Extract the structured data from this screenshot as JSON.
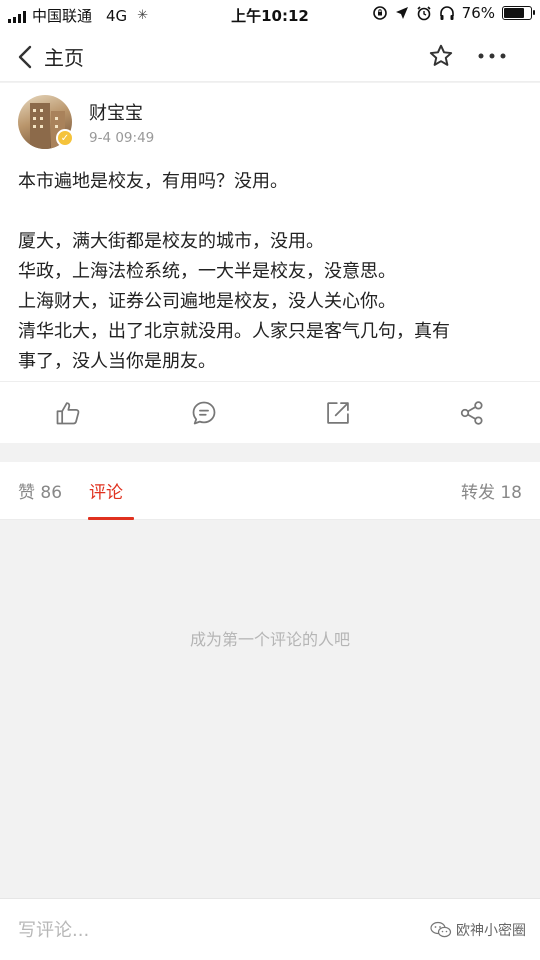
{
  "status_bar": {
    "carrier": "中国联通",
    "network": "4G",
    "time": "上午10:12",
    "battery_percent": "76%",
    "battery_level": 0.76
  },
  "nav": {
    "title": "主页",
    "icons": [
      "back-arrow-icon",
      "star-icon",
      "more-icon"
    ]
  },
  "post": {
    "author": "财宝宝",
    "time": "9-4 09:49",
    "lines": [
      "本市遍地是校友，有用吗？没用。",
      "",
      "厦大，满大街都是校友的城市，没用。",
      "华政，上海法检系统，一大半是校友，没意思。",
      "上海财大，证券公司遍地是校友，没人关心你。",
      "清华北大，出了北京就没用。人家只是客气几句，真有",
      "事了，没人当你是朋友。"
    ],
    "action_icons": [
      "like-icon",
      "comment-icon",
      "repost-icon",
      "share-icon"
    ]
  },
  "tabs": {
    "likes": "赞 86",
    "comments": "评论",
    "reposts": "转发 18",
    "active_color": "#e0311f"
  },
  "comments": {
    "empty_text": "成为第一个评论的人吧"
  },
  "bottom": {
    "placeholder": "写评论...",
    "watermark": "欧神小密圈"
  }
}
